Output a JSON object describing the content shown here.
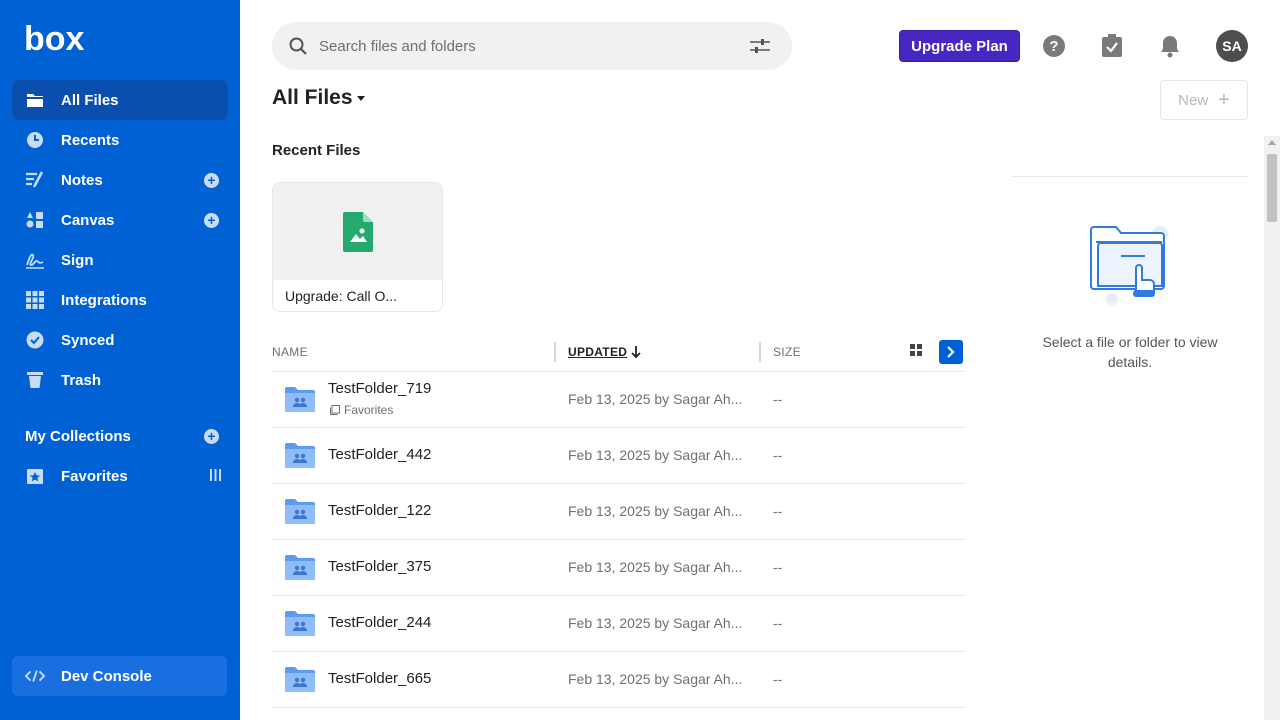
{
  "brand": {
    "logo_text": "box"
  },
  "sidebar": {
    "items": [
      {
        "label": "All Files",
        "icon": "folder-icon",
        "active": true
      },
      {
        "label": "Recents",
        "icon": "clock-icon"
      },
      {
        "label": "Notes",
        "icon": "notes-icon",
        "has_add": true
      },
      {
        "label": "Canvas",
        "icon": "canvas-icon",
        "has_add": true
      },
      {
        "label": "Sign",
        "icon": "signature-icon"
      },
      {
        "label": "Integrations",
        "icon": "grid-apps-icon"
      },
      {
        "label": "Synced",
        "icon": "check-circle-icon"
      },
      {
        "label": "Trash",
        "icon": "trash-icon"
      }
    ],
    "collections_title": "My Collections",
    "favorites_label": "Favorites",
    "dev_console_label": "Dev Console"
  },
  "header": {
    "search_placeholder": "Search files and folders",
    "upgrade_label": "Upgrade Plan",
    "avatar_initials": "SA"
  },
  "main": {
    "title": "All Files",
    "new_label": "New",
    "recent_title": "Recent Files",
    "recent_files": [
      {
        "name": "Upgrade: Call O..."
      }
    ],
    "columns": {
      "name": "NAME",
      "updated": "UPDATED",
      "size": "SIZE"
    },
    "rows": [
      {
        "name": "TestFolder_719",
        "tag": "Favorites",
        "updated": "Feb 13, 2025 by Sagar Ah...",
        "size": "--"
      },
      {
        "name": "TestFolder_442",
        "updated": "Feb 13, 2025 by Sagar Ah...",
        "size": "--"
      },
      {
        "name": "TestFolder_122",
        "updated": "Feb 13, 2025 by Sagar Ah...",
        "size": "--"
      },
      {
        "name": "TestFolder_375",
        "updated": "Feb 13, 2025 by Sagar Ah...",
        "size": "--"
      },
      {
        "name": "TestFolder_244",
        "updated": "Feb 13, 2025 by Sagar Ah...",
        "size": "--"
      },
      {
        "name": "TestFolder_665",
        "updated": "Feb 13, 2025 by Sagar Ah...",
        "size": "--"
      }
    ]
  },
  "details": {
    "empty_text": "Select a file or folder to view details."
  },
  "colors": {
    "sidebar": "#0061d5",
    "upgrade": "#4826c2",
    "folder": "#6fa8f0",
    "file_green": "#26a96c"
  }
}
